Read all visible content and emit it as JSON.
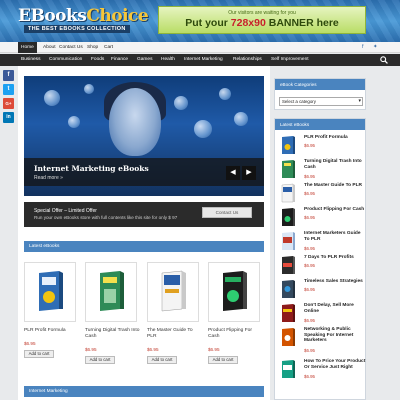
{
  "logo": {
    "part1": "EBooks",
    "part2": "Choice",
    "tagline": "THE BEST EBOOKS COLLECTION"
  },
  "banner": {
    "line1": "Our visitors are waiting for you",
    "line2_prefix": "Put your ",
    "line2_highlight": "728x90",
    "line2_suffix": " BANNER here"
  },
  "topnav": {
    "items": [
      "Home",
      "About",
      "Contact Us",
      "Shop",
      "Cart"
    ],
    "active": "Home"
  },
  "categories": [
    "Business",
    "Communication",
    "Foods",
    "Finance",
    "Games",
    "Health",
    "Internet Marketing",
    "Relationships",
    "Self Improvement"
  ],
  "share": [
    "f",
    "t",
    "G+",
    "in",
    "+"
  ],
  "slider": {
    "title": "Internet Marketing eBooks",
    "more": "Read more »",
    "prev": "◀",
    "next": "▶"
  },
  "offer": {
    "title": "Special Offer – Limited Offer",
    "text": "Run your own eBooks store with full contents like this site for only $ 97",
    "button": "Contact Us"
  },
  "latest": {
    "heading": "Latest eBooks",
    "products": [
      {
        "name": "PLR Profit Formula",
        "price": "$6.95",
        "button": "Add to cart"
      },
      {
        "name": "Turning Digital Trash Into Cash",
        "price": "$6.95",
        "button": "Add to cart"
      },
      {
        "name": "The Master Guide To PLR",
        "price": "$6.95",
        "button": "Add to cart"
      },
      {
        "name": "Product Flipping For Cash",
        "price": "$6.95",
        "button": "Add to cart"
      }
    ]
  },
  "internet_marketing": {
    "heading": "Internet Marketing"
  },
  "sidebar": {
    "categories_heading": "eBook Categories",
    "select_placeholder": "Select a category",
    "latest_heading": "Latest eBooks",
    "items": [
      {
        "title": "PLR Profit Formula",
        "price": "$6.95"
      },
      {
        "title": "Turning Digital Trash Into Cash",
        "price": "$6.95"
      },
      {
        "title": "The Master Guide To PLR",
        "price": "$6.95"
      },
      {
        "title": "Product Flipping For Cash",
        "price": "$6.95"
      },
      {
        "title": "Internet Marketers Guide To PLR",
        "price": "$6.95"
      },
      {
        "title": "7 Days To PLR Profits",
        "price": "$6.95"
      },
      {
        "title": "Timeless Sales Strategies",
        "price": "$6.95"
      },
      {
        "title": "Don't Delay, Sell More Online",
        "price": "$6.95"
      },
      {
        "title": "Networking & Public Speaking For Internet Marketers",
        "price": "$6.95"
      },
      {
        "title": "How To Price Your Product Or Service Just Right",
        "price": "$6.95"
      }
    ]
  }
}
